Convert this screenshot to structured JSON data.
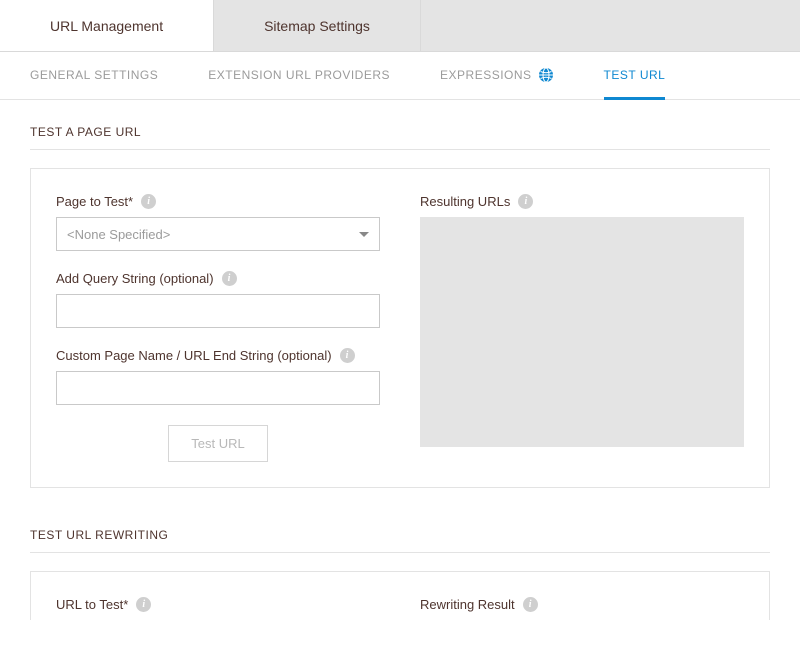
{
  "topTabs": {
    "urlManagement": "URL Management",
    "sitemapSettings": "Sitemap Settings"
  },
  "subTabs": {
    "generalSettings": "GENERAL SETTINGS",
    "extensionUrlProviders": "EXTENSION URL PROVIDERS",
    "expressions": "EXPRESSIONS",
    "testUrl": "TEST URL"
  },
  "section1": {
    "title": "TEST A PAGE URL",
    "pageToTestLabel": "Page to Test*",
    "pageToTestValue": "<None Specified>",
    "addQueryLabel": "Add Query String (optional)",
    "addQueryValue": "",
    "customPageNameLabel": "Custom Page Name / URL End String (optional)",
    "customPageNameValue": "",
    "testButton": "Test URL",
    "resultingUrlsLabel": "Resulting URLs"
  },
  "section2": {
    "title": "TEST URL REWRITING",
    "urlToTestLabel": "URL to Test*",
    "rewritingResultLabel": "Rewriting Result"
  }
}
